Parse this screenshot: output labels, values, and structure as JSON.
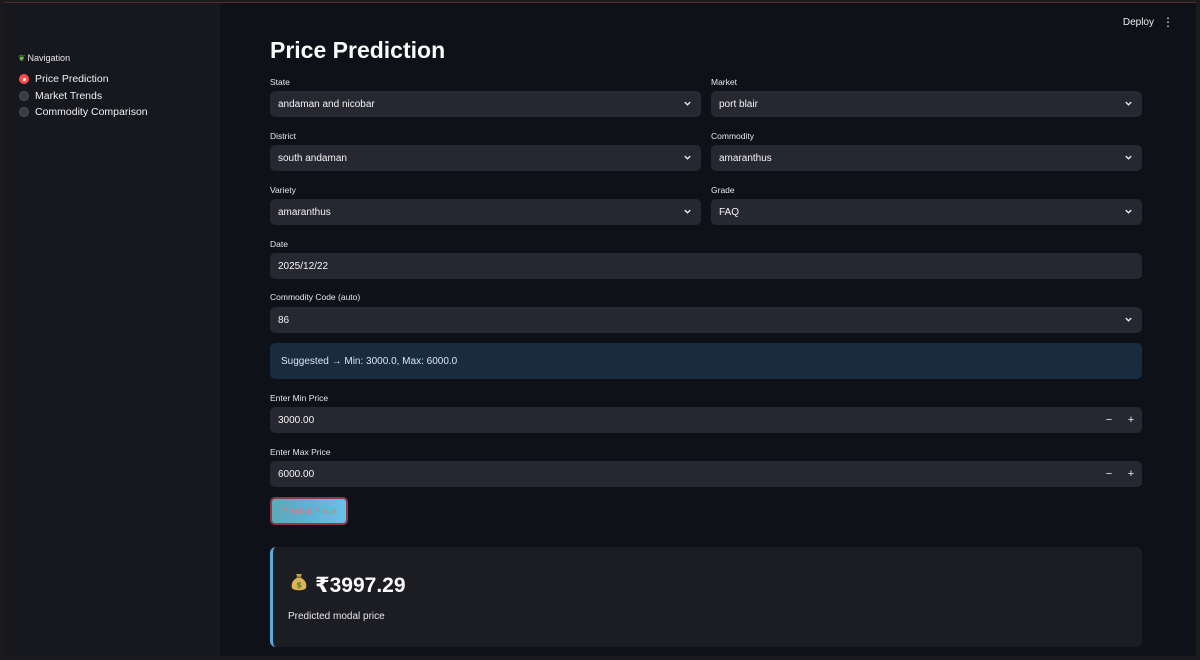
{
  "header": {
    "deploy_label": "Deploy",
    "menu_icon": "kebab-menu-icon"
  },
  "sidebar": {
    "nav_title": "Navigation",
    "nav_icon": "leaf-icon",
    "items": [
      {
        "label": "Price Prediction",
        "selected": true
      },
      {
        "label": "Market Trends",
        "selected": false
      },
      {
        "label": "Commodity Comparison",
        "selected": false
      }
    ]
  },
  "main": {
    "title": "Price Prediction",
    "state": {
      "label": "State",
      "value": "andaman and nicobar"
    },
    "market": {
      "label": "Market",
      "value": "port blair"
    },
    "district": {
      "label": "District",
      "value": "south andaman"
    },
    "commodity": {
      "label": "Commodity",
      "value": "amaranthus"
    },
    "variety": {
      "label": "Variety",
      "value": "amaranthus"
    },
    "grade": {
      "label": "Grade",
      "value": "FAQ"
    },
    "date": {
      "label": "Date",
      "value": "2025/12/22"
    },
    "commodity_code": {
      "label": "Commodity Code (auto)",
      "value": "86"
    },
    "suggestion": "Suggested → Min: 3000.0, Max: 6000.0",
    "min_price": {
      "label": "Enter Min Price",
      "value": "3000.00"
    },
    "max_price": {
      "label": "Enter Max Price",
      "value": "6000.00"
    },
    "stepper_minus": "−",
    "stepper_plus": "+",
    "predict_label": "Predict Price",
    "result": {
      "icon": "money-bag-icon",
      "price": "₹3997.29",
      "caption": "Predicted modal price"
    }
  },
  "colors": {
    "background": "#0e1117",
    "sidebar": "#16181e",
    "input": "#262730",
    "accent": "#ff4b4b",
    "info": "#1a2a3f",
    "result_border": "#5da9e0"
  }
}
